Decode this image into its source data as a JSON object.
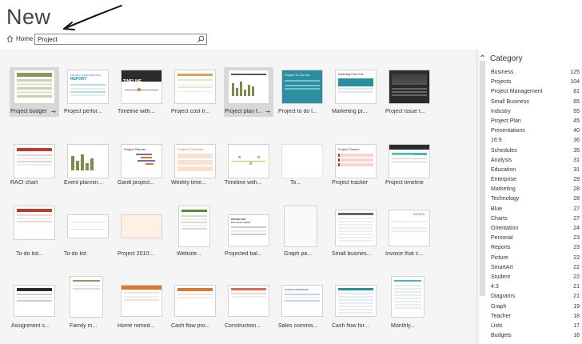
{
  "page": {
    "title": "New"
  },
  "nav": {
    "home_label": "Home"
  },
  "search": {
    "value": "Project"
  },
  "templates": [
    {
      "label": "Project budget",
      "selected": true
    },
    {
      "label": "Project perfor...",
      "selected": false
    },
    {
      "label": "Timeline with...",
      "selected": false
    },
    {
      "label": "Project cost tr...",
      "selected": false
    },
    {
      "label": "Project plan f...",
      "selected": true
    },
    {
      "label": "Project to do l...",
      "selected": false
    },
    {
      "label": "Marketing pr...",
      "selected": false
    },
    {
      "label": "Project issue t...",
      "selected": false
    },
    {
      "label": "RACI chart",
      "selected": false
    },
    {
      "label": "Event planning...",
      "selected": false
    },
    {
      "label": "Gantt project...",
      "selected": false
    },
    {
      "label": "Weekly time...",
      "selected": false
    },
    {
      "label": "Timeline with...",
      "selected": false
    },
    {
      "label": "To...",
      "selected": false
    },
    {
      "label": "Project tracker",
      "selected": false
    },
    {
      "label": "Project timeline",
      "selected": false
    },
    {
      "label": "To-do list...",
      "selected": false
    },
    {
      "label": "To-do list",
      "selected": false
    },
    {
      "label": "Project 2010:...",
      "selected": false
    },
    {
      "label": "Website...",
      "selected": false
    },
    {
      "label": "Projected bal...",
      "selected": false
    },
    {
      "label": "Graph pa...",
      "selected": false
    },
    {
      "label": "Small busines...",
      "selected": false
    },
    {
      "label": "Invoice that c...",
      "selected": false
    },
    {
      "label": "Assignment s...",
      "selected": false
    },
    {
      "label": "Family m...",
      "selected": false
    },
    {
      "label": "Home remod...",
      "selected": false
    },
    {
      "label": "Cash flow pro...",
      "selected": false
    },
    {
      "label": "Construction...",
      "selected": false
    },
    {
      "label": "Sales commis...",
      "selected": false
    },
    {
      "label": "Cash flow for...",
      "selected": false
    },
    {
      "label": "Monthly...",
      "selected": false
    }
  ],
  "thumb_text": {
    "t2_line1": "PROJECT PERFORMANCE",
    "t2_line2": "REPORT",
    "t3": "TIMELINE",
    "t6": "Project To Do List",
    "t7": "Marketing Plan Role",
    "t11": "Project Planner",
    "t12": "Projects Overview",
    "t15": "Project Tracker",
    "t16": "PROJECT TIMELINE",
    "t21_line1": "PROJECTED",
    "t21_line2": "BALANCE SHEET",
    "t24": "INVOICE",
    "t27": "REMODEL",
    "t30": "SALES COMMISSION"
  },
  "category": {
    "title": "Category",
    "items": [
      {
        "name": "Business",
        "count": "125"
      },
      {
        "name": "Projects",
        "count": "104"
      },
      {
        "name": "Project Management",
        "count": "81"
      },
      {
        "name": "Small Business",
        "count": "65"
      },
      {
        "name": "Industry",
        "count": "55"
      },
      {
        "name": "Project Plan",
        "count": "45"
      },
      {
        "name": "Presentations",
        "count": "40"
      },
      {
        "name": "16:9",
        "count": "36"
      },
      {
        "name": "Schedules",
        "count": "35"
      },
      {
        "name": "Analysis",
        "count": "31"
      },
      {
        "name": "Education",
        "count": "31"
      },
      {
        "name": "Enterprise",
        "count": "29"
      },
      {
        "name": "Marketing",
        "count": "28"
      },
      {
        "name": "Technology",
        "count": "28"
      },
      {
        "name": "Blue",
        "count": "27"
      },
      {
        "name": "Charts",
        "count": "27"
      },
      {
        "name": "Orientation",
        "count": "24"
      },
      {
        "name": "Personal",
        "count": "23"
      },
      {
        "name": "Reports",
        "count": "23"
      },
      {
        "name": "Picture",
        "count": "22"
      },
      {
        "name": "SmartArt",
        "count": "22"
      },
      {
        "name": "Student",
        "count": "22"
      },
      {
        "name": "4:3",
        "count": "21"
      },
      {
        "name": "Diagrams",
        "count": "21"
      },
      {
        "name": "Graph",
        "count": "19"
      },
      {
        "name": "Teacher",
        "count": "18"
      },
      {
        "name": "Lists",
        "count": "17"
      },
      {
        "name": "Budgets",
        "count": "16"
      }
    ]
  },
  "colors": {
    "accent_green": "#7a8e4a",
    "accent_teal": "#2b8fa0",
    "accent_orange": "#d9772e",
    "accent_dark": "#2b2b2b",
    "accent_red": "#c0392b"
  }
}
